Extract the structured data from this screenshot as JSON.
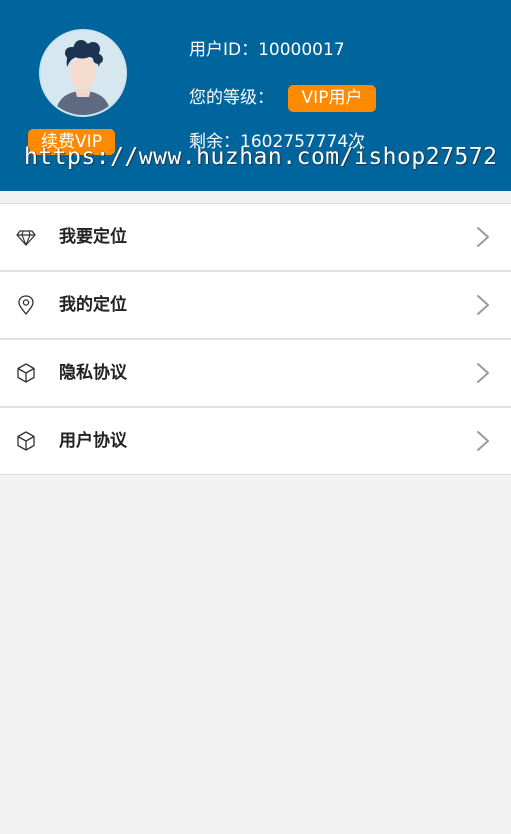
{
  "header": {
    "renew_label": "续费VIP",
    "user_id_line": "用户ID：10000017",
    "level_label": "您的等级：",
    "level_badge": "VIP用户",
    "remaining_line": "剩余：1602757774次",
    "watermark": "https://www.huzhan.com/ishop27572",
    "background_color": "#00659c",
    "accent_color": "#ff8a00"
  },
  "menu": {
    "items": [
      {
        "label": "我要定位",
        "icon": "diamond-icon"
      },
      {
        "label": "我的定位",
        "icon": "location-pin-icon"
      },
      {
        "label": "隐私协议",
        "icon": "cube-icon"
      },
      {
        "label": "用户协议",
        "icon": "cube-icon"
      }
    ]
  }
}
